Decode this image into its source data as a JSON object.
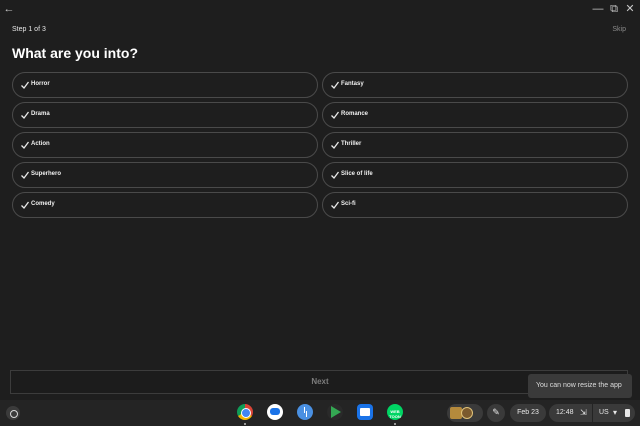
{
  "window": {
    "back_glyph": "←",
    "minimize_glyph": "—",
    "restore_glyph": "⧉",
    "close_glyph": "✕"
  },
  "onboarding": {
    "step_text": "Step 1 of 3",
    "skip_label": "Skip",
    "heading": "What are you into?",
    "genres": [
      {
        "label": "Horror",
        "selected": true
      },
      {
        "label": "Fantasy",
        "selected": true
      },
      {
        "label": "Drama",
        "selected": true
      },
      {
        "label": "Romance",
        "selected": true
      },
      {
        "label": "Action",
        "selected": true
      },
      {
        "label": "Thriller",
        "selected": true
      },
      {
        "label": "Superhero",
        "selected": true
      },
      {
        "label": "Slice of life",
        "selected": true
      },
      {
        "label": "Comedy",
        "selected": true
      },
      {
        "label": "Sci-fi",
        "selected": true
      }
    ],
    "next_label": "Next"
  },
  "toast": {
    "text": "You can now resize the app"
  },
  "shelf": {
    "apps": [
      "chrome-icon",
      "messages-icon",
      "clock-icon",
      "play-store-icon",
      "files-icon",
      "webtoon-icon"
    ],
    "webtoon_text": "WEB TOON",
    "pen_glyph": "✎",
    "date": "Feb 23",
    "time": "12:48",
    "cast_glyph": "⇲",
    "keyboard_layout": "US",
    "wifi_glyph": "▾"
  },
  "colors": {
    "background": "#1e1e1e",
    "chip_border": "#4a4a4a",
    "shelf": "#242424"
  }
}
